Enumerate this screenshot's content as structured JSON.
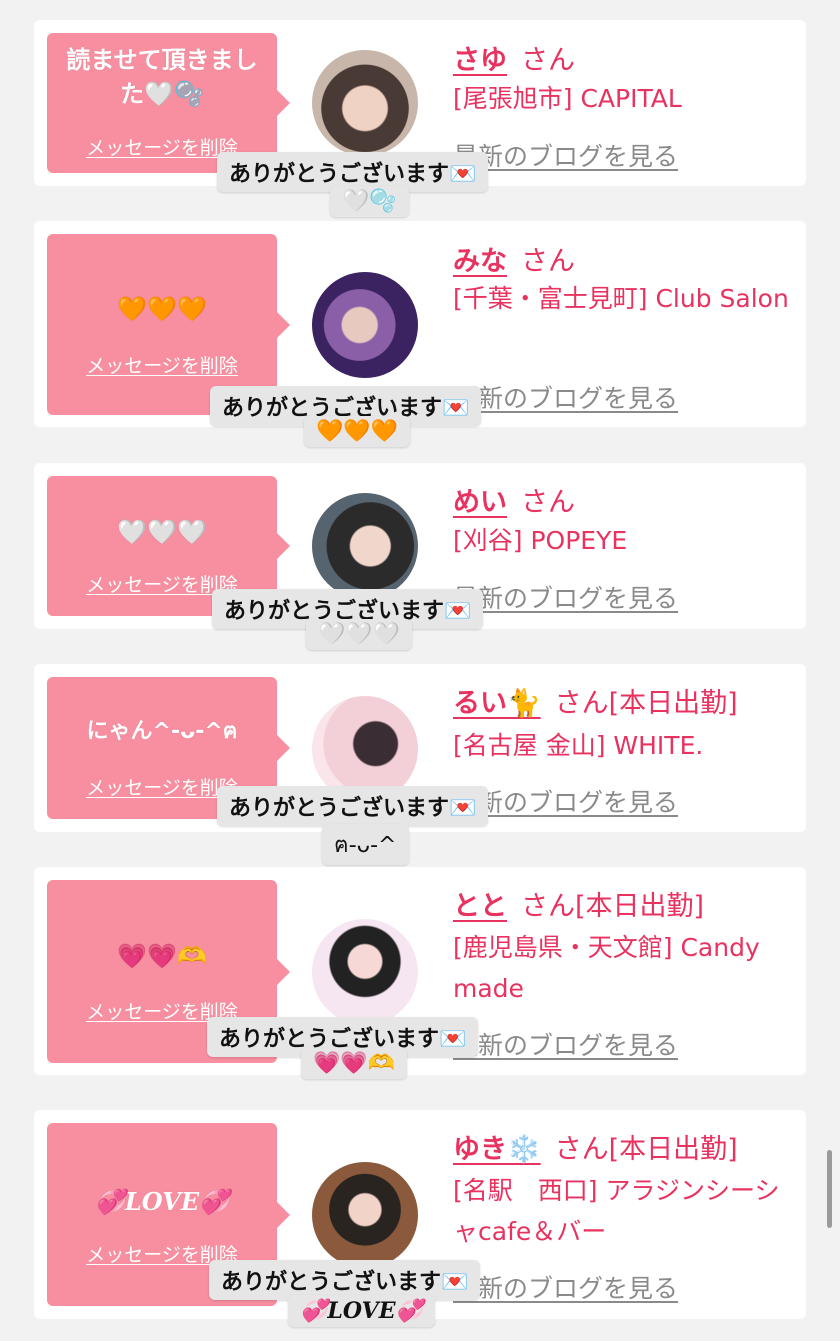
{
  "delete_label": "メッセージを削除",
  "san": "さん",
  "blog_link": "最新のブログを見る",
  "thanks": "ありがとうございます💌",
  "entries": [
    {
      "message": "読ませて頂きました🤍🫧",
      "name": "さゆ",
      "suffix": "",
      "shop": "[尾張旭市] CAPITAL",
      "reply": "🤍🫧"
    },
    {
      "message": "🧡🧡🧡",
      "name": "みな",
      "suffix": "",
      "shop": "[千葉・富士見町] Club Salon",
      "reply": "🧡🧡🧡"
    },
    {
      "message": "🤍🤍🤍",
      "name": "めい",
      "suffix": "",
      "shop": "[刈谷] POPEYE",
      "reply": "🤍🤍🤍"
    },
    {
      "message": "にゃん^-ᴗ-^ฅ",
      "name": "るい🐈",
      "suffix": "[本日出勤]",
      "shop": "[名古屋 金山] WHITE.",
      "reply": "ฅ-ᴗ-^"
    },
    {
      "message": "💗💗🫶",
      "name": "とと",
      "suffix": "[本日出勤]",
      "shop": "[鹿児島県・天文館] Candy made",
      "reply": "💗💗🫶"
    },
    {
      "message": "💞LOVE💞",
      "name": "ゆき❄️",
      "suffix": "[本日出勤]",
      "shop": "[名駅　西口] アラジンシーシャcafe＆バー",
      "reply": "💞LOVE💞"
    }
  ]
}
